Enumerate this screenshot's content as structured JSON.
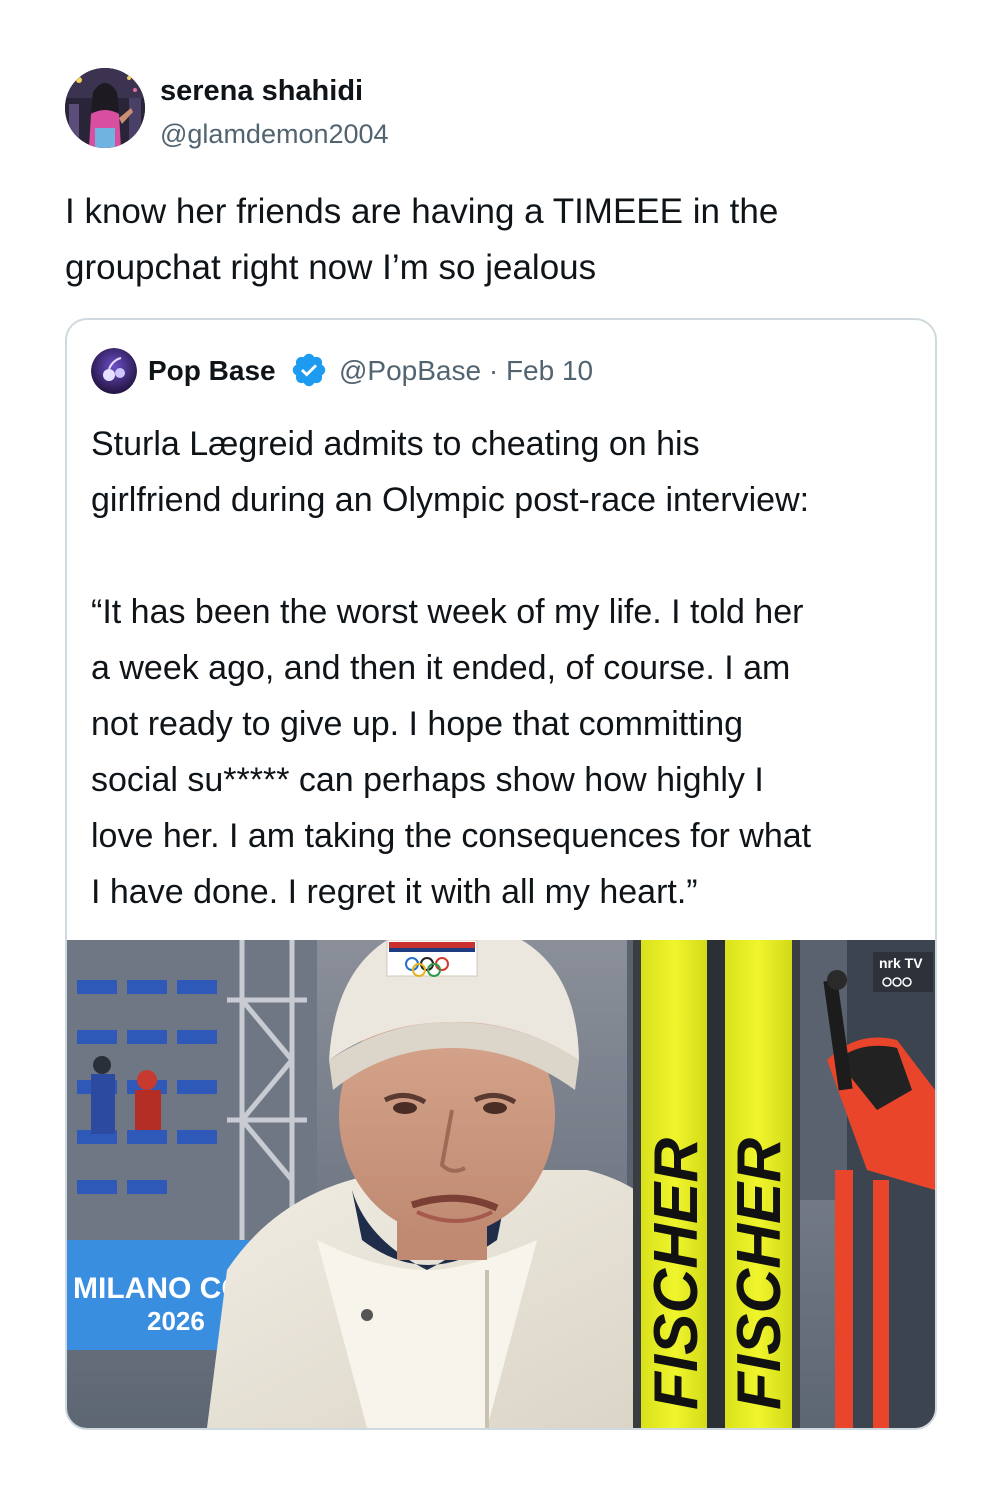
{
  "tweet": {
    "author_name": "serena shahidi",
    "author_handle": "@glamdemon2004",
    "text_line1": "I know her friends are having a TIMEEE in the",
    "text_line2": "groupchat right now I’m so jealous"
  },
  "quoted_tweet": {
    "author_name": "Pop Base",
    "verified": true,
    "handle_and_date": "@PopBase · Feb 10",
    "para1_line1": "Sturla Lægreid admits to cheating on his",
    "para1_line2": "girlfriend during an Olympic post-race interview:",
    "para2_lines": [
      "“It has been the worst week of my life. I told her",
      "a week ago, and then it ended, of course. I am",
      "not ready to give up. I hope that committing",
      "social su***** can perhaps show how highly I",
      "love her. I am taking the consequences for what",
      "I have done. I regret it with all my heart.”"
    ],
    "media": {
      "banner_line1": "MILANO COR",
      "banner_line2": "2026",
      "broadcaster": "nrk TV",
      "ski_brand": "FISCHER"
    }
  },
  "colors": {
    "text": "#0f1419",
    "secondary": "#536471",
    "border": "#cfd9de",
    "verified": "#1d9bf0",
    "ski_yellow": "#e8ee1c",
    "pole_red": "#e8452a"
  }
}
